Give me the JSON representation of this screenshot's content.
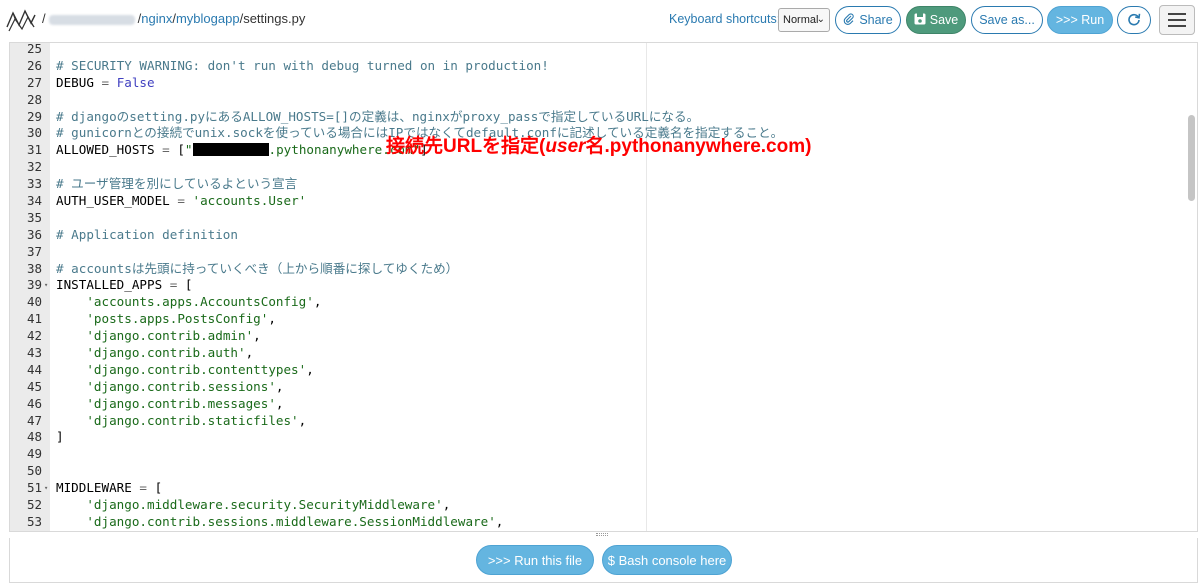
{
  "breadcrumb": {
    "leading_slash": "/",
    "user_blurred": "",
    "sep1": "/",
    "dir1": "nginx",
    "sep2": "/",
    "dir2": "myblogapp",
    "sep3": "/",
    "file": "settings.py"
  },
  "toolbar": {
    "keyboard_shortcuts_label": "Keyboard shortcuts:",
    "mode_value": "Normal",
    "share_label": "Share",
    "save_label": "Save",
    "save_as_label": "Save as...",
    "run_label": ">>> Run"
  },
  "editor": {
    "lines": [
      {
        "n": "25",
        "fold": false,
        "parts": []
      },
      {
        "n": "26",
        "fold": false,
        "parts": [
          {
            "t": "cmt",
            "v": "# SECURITY WARNING: don't run with debug turned on in production!"
          }
        ]
      },
      {
        "n": "27",
        "fold": false,
        "parts": [
          {
            "t": "",
            "v": "DEBUG "
          },
          {
            "t": "op",
            "v": "="
          },
          {
            "t": "",
            "v": " "
          },
          {
            "t": "kw",
            "v": "False"
          }
        ]
      },
      {
        "n": "28",
        "fold": false,
        "parts": []
      },
      {
        "n": "29",
        "fold": false,
        "parts": [
          {
            "t": "cmt",
            "v": "# djangoのsetting.pyにあるALLOW_HOSTS=[]の定義は、nginxがproxy_passで指定しているURLになる。"
          }
        ]
      },
      {
        "n": "30",
        "fold": false,
        "parts": [
          {
            "t": "cmt",
            "v": "# gunicornとの接続でunix.sockを使っている場合にはIPではなくてdefault.confに記述している定義名を指定すること。"
          }
        ]
      },
      {
        "n": "31",
        "fold": false,
        "parts": [
          {
            "t": "",
            "v": "ALLOWED_HOSTS "
          },
          {
            "t": "op",
            "v": "="
          },
          {
            "t": "",
            "v": " ["
          },
          {
            "t": "str",
            "v": "\""
          },
          {
            "t": "redact",
            "v": ""
          },
          {
            "t": "str",
            "v": ".pythonanywhere.com\""
          },
          {
            "t": "",
            "v": "]"
          }
        ]
      },
      {
        "n": "32",
        "fold": false,
        "parts": []
      },
      {
        "n": "33",
        "fold": false,
        "parts": [
          {
            "t": "cmt",
            "v": "# ユーザ管理を別にしているよという宣言"
          }
        ]
      },
      {
        "n": "34",
        "fold": false,
        "parts": [
          {
            "t": "",
            "v": "AUTH_USER_MODEL "
          },
          {
            "t": "op",
            "v": "="
          },
          {
            "t": "",
            "v": " "
          },
          {
            "t": "str",
            "v": "'accounts.User'"
          }
        ]
      },
      {
        "n": "35",
        "fold": false,
        "parts": []
      },
      {
        "n": "36",
        "fold": false,
        "parts": [
          {
            "t": "cmt",
            "v": "# Application definition"
          }
        ]
      },
      {
        "n": "37",
        "fold": false,
        "parts": []
      },
      {
        "n": "38",
        "fold": false,
        "parts": [
          {
            "t": "cmt",
            "v": "# accountsは先頭に持っていくべき（上から順番に探してゆくため）"
          }
        ]
      },
      {
        "n": "39",
        "fold": true,
        "parts": [
          {
            "t": "",
            "v": "INSTALLED_APPS "
          },
          {
            "t": "op",
            "v": "="
          },
          {
            "t": "",
            "v": " ["
          }
        ]
      },
      {
        "n": "40",
        "fold": false,
        "parts": [
          {
            "t": "",
            "v": "    "
          },
          {
            "t": "str",
            "v": "'accounts.apps.AccountsConfig'"
          },
          {
            "t": "",
            "v": ","
          }
        ]
      },
      {
        "n": "41",
        "fold": false,
        "parts": [
          {
            "t": "",
            "v": "    "
          },
          {
            "t": "str",
            "v": "'posts.apps.PostsConfig'"
          },
          {
            "t": "",
            "v": ","
          }
        ]
      },
      {
        "n": "42",
        "fold": false,
        "parts": [
          {
            "t": "",
            "v": "    "
          },
          {
            "t": "str",
            "v": "'django.contrib.admin'"
          },
          {
            "t": "",
            "v": ","
          }
        ]
      },
      {
        "n": "43",
        "fold": false,
        "parts": [
          {
            "t": "",
            "v": "    "
          },
          {
            "t": "str",
            "v": "'django.contrib.auth'"
          },
          {
            "t": "",
            "v": ","
          }
        ]
      },
      {
        "n": "44",
        "fold": false,
        "parts": [
          {
            "t": "",
            "v": "    "
          },
          {
            "t": "str",
            "v": "'django.contrib.contenttypes'"
          },
          {
            "t": "",
            "v": ","
          }
        ]
      },
      {
        "n": "45",
        "fold": false,
        "parts": [
          {
            "t": "",
            "v": "    "
          },
          {
            "t": "str",
            "v": "'django.contrib.sessions'"
          },
          {
            "t": "",
            "v": ","
          }
        ]
      },
      {
        "n": "46",
        "fold": false,
        "parts": [
          {
            "t": "",
            "v": "    "
          },
          {
            "t": "str",
            "v": "'django.contrib.messages'"
          },
          {
            "t": "",
            "v": ","
          }
        ]
      },
      {
        "n": "47",
        "fold": false,
        "parts": [
          {
            "t": "",
            "v": "    "
          },
          {
            "t": "str",
            "v": "'django.contrib.staticfiles'"
          },
          {
            "t": "",
            "v": ","
          }
        ]
      },
      {
        "n": "48",
        "fold": false,
        "parts": [
          {
            "t": "",
            "v": "]"
          }
        ]
      },
      {
        "n": "49",
        "fold": false,
        "parts": []
      },
      {
        "n": "50",
        "fold": false,
        "parts": []
      },
      {
        "n": "51",
        "fold": true,
        "parts": [
          {
            "t": "",
            "v": "MIDDLEWARE "
          },
          {
            "t": "op",
            "v": "="
          },
          {
            "t": "",
            "v": " ["
          }
        ]
      },
      {
        "n": "52",
        "fold": false,
        "parts": [
          {
            "t": "",
            "v": "    "
          },
          {
            "t": "str",
            "v": "'django.middleware.security.SecurityMiddleware'"
          },
          {
            "t": "",
            "v": ","
          }
        ]
      },
      {
        "n": "53",
        "fold": false,
        "parts": [
          {
            "t": "",
            "v": "    "
          },
          {
            "t": "str",
            "v": "'django.contrib.sessions.middleware.SessionMiddleware'"
          },
          {
            "t": "",
            "v": ","
          }
        ]
      }
    ],
    "annotation": {
      "part1": "接続先URLを指定(",
      "part2": "user",
      "part3": "名.pythonanywhere.com)"
    }
  },
  "footer": {
    "run_file_label": ">>> Run this file",
    "bash_console_label": "$ Bash console here"
  },
  "colors": {
    "link": "#2a7ab0",
    "save": "#4e9a7c",
    "run": "#64b5e0",
    "annotation": "#ff0000",
    "comment": "#4a7a8c",
    "string": "#1a6a1a",
    "keyword": "#4040c0"
  }
}
